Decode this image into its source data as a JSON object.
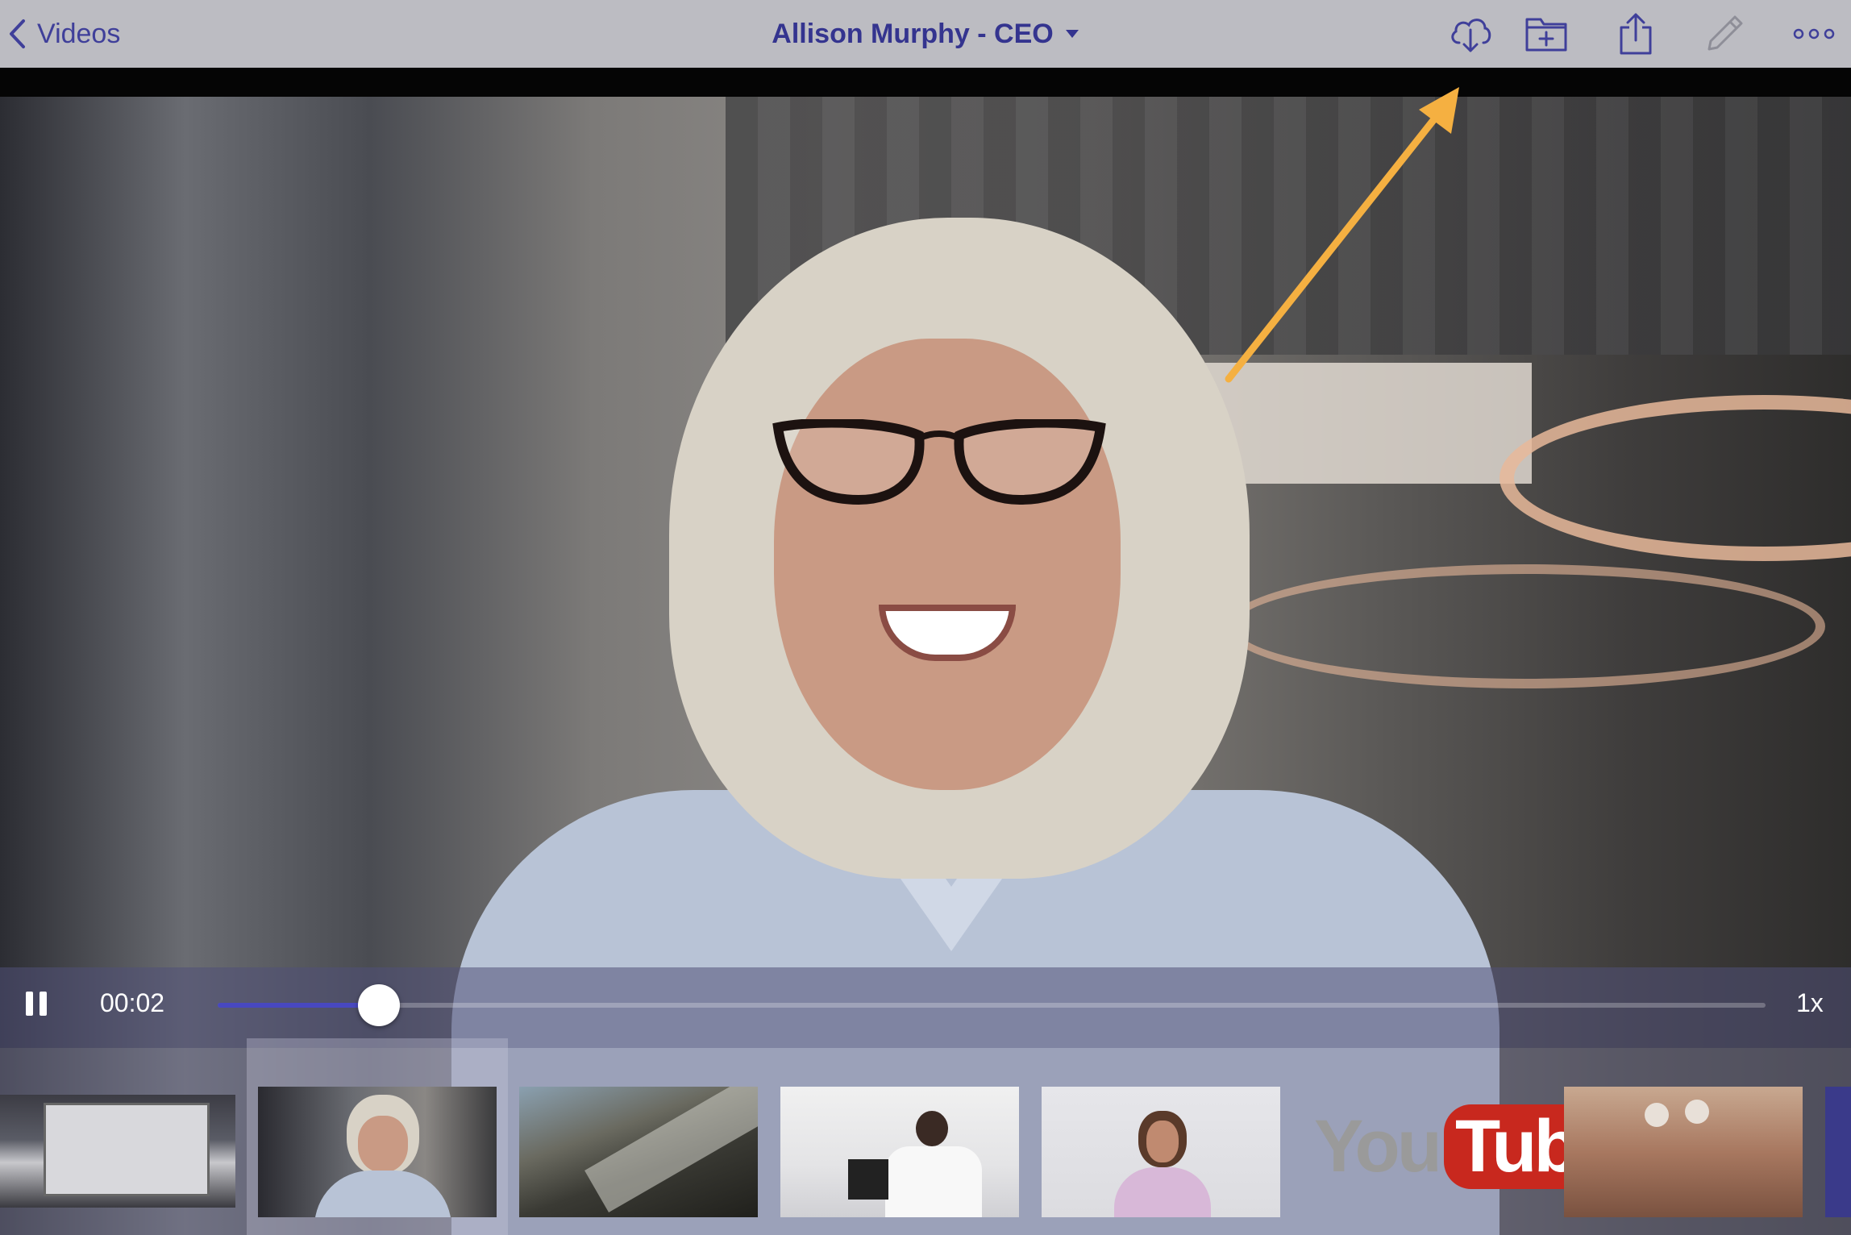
{
  "nav": {
    "back_label": "Videos",
    "title": "Allison Murphy - CEO"
  },
  "toolbar": {
    "icons": [
      "cloud-download-icon",
      "folder-add-icon",
      "share-icon",
      "pencil-icon",
      "more-icon"
    ]
  },
  "player": {
    "current_time": "00:02",
    "speed": "1x",
    "progress": 0.104
  },
  "filmstrip": {
    "selected_index": 1,
    "youtube_you": "You",
    "youtube_tube": "Tube"
  },
  "colors": {
    "accent": "#3f3f9a",
    "arrow": "#f5b041"
  }
}
